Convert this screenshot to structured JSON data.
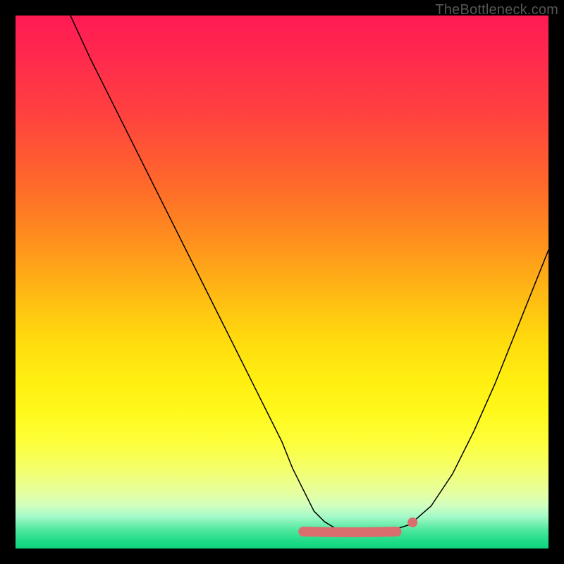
{
  "watermark": "TheBottleneck.com",
  "colors": {
    "background": "#000000",
    "curve_stroke": "#000000",
    "marker_fill": "#da6e6e",
    "marker_stroke": "#b85a5a",
    "grad_top": "#ff1a53",
    "grad_bottom": "#0fd67e"
  },
  "chart_data": {
    "type": "line",
    "title": "",
    "xlabel": "",
    "ylabel": "",
    "xlim": [
      0,
      100
    ],
    "ylim": [
      0,
      100
    ],
    "grid": false,
    "legend": false,
    "series": [
      {
        "name": "bottleneck-curve",
        "x": [
          10.3,
          14,
          18,
          22,
          26,
          30,
          34,
          38,
          42,
          46,
          50,
          52,
          54,
          56,
          58,
          60,
          62,
          64,
          66,
          68,
          70,
          74,
          78,
          82,
          86,
          90,
          94,
          98,
          100
        ],
        "y": [
          100,
          92,
          84,
          76,
          68,
          60,
          52,
          44,
          36,
          28,
          20,
          15,
          11,
          7,
          5,
          3.8,
          3.2,
          3.0,
          3.0,
          3.0,
          3.2,
          4.5,
          8,
          14,
          22,
          31,
          41,
          51,
          56
        ]
      }
    ],
    "annotations": [
      {
        "name": "bottom-band",
        "kind": "thick-segment",
        "x_range": [
          54,
          71.5
        ],
        "y": 3.3
      },
      {
        "name": "detached-dot",
        "kind": "point",
        "x": 74.5,
        "y": 4.9
      }
    ]
  }
}
